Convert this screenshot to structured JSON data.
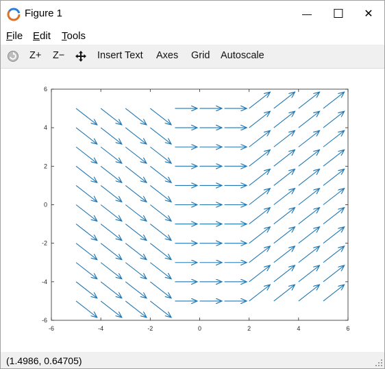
{
  "window": {
    "title": "Figure 1",
    "controls": {
      "minimize": "—",
      "maximize": "☐",
      "close": "✕"
    }
  },
  "menubar": {
    "items": [
      {
        "label": "File",
        "mnemonic": "F",
        "rest": "ile"
      },
      {
        "label": "Edit",
        "mnemonic": "E",
        "rest": "dit"
      },
      {
        "label": "Tools",
        "mnemonic": "T",
        "rest": "ools"
      }
    ]
  },
  "toolbar": {
    "rotate_icon": "rotate-icon",
    "zoom_in_label": "Z+",
    "zoom_out_label": "Z−",
    "pan_icon": "pan-icon",
    "insert_text_label": "Insert Text",
    "axes_label": "Axes",
    "grid_label": "Grid",
    "autoscale_label": "Autoscale"
  },
  "status": {
    "coordinates": "(1.4986, 0.64705)"
  },
  "colors": {
    "arrow": "#1f77b4",
    "axis": "#262626",
    "toolbar_bg": "#f0f0f0"
  },
  "chart_data": {
    "type": "quiver",
    "title": "",
    "xlabel": "",
    "ylabel": "",
    "xlim": [
      -6,
      6
    ],
    "ylim": [
      -6,
      6
    ],
    "xticks": [
      "-6",
      "-4",
      "-2",
      "0",
      "2",
      "4",
      "6"
    ],
    "yticks": [
      "6",
      "4",
      "2",
      "0",
      "-2",
      "-4",
      "-6"
    ],
    "grid": false,
    "x": [
      -5,
      -4,
      -3,
      -2,
      -1,
      0,
      1,
      2,
      3,
      4,
      5
    ],
    "y": [
      5,
      4,
      3,
      2,
      1,
      0,
      -1,
      -2,
      -3,
      -4,
      -5
    ],
    "vectors": [
      {
        "x_range": [
          -5,
          -2
        ],
        "u": 0.85,
        "v": -0.85
      },
      {
        "x_range": [
          -1,
          1
        ],
        "u": 0.9,
        "v": 0.0
      },
      {
        "x_range": [
          2,
          5
        ],
        "u": 0.85,
        "v": 0.85
      }
    ]
  }
}
